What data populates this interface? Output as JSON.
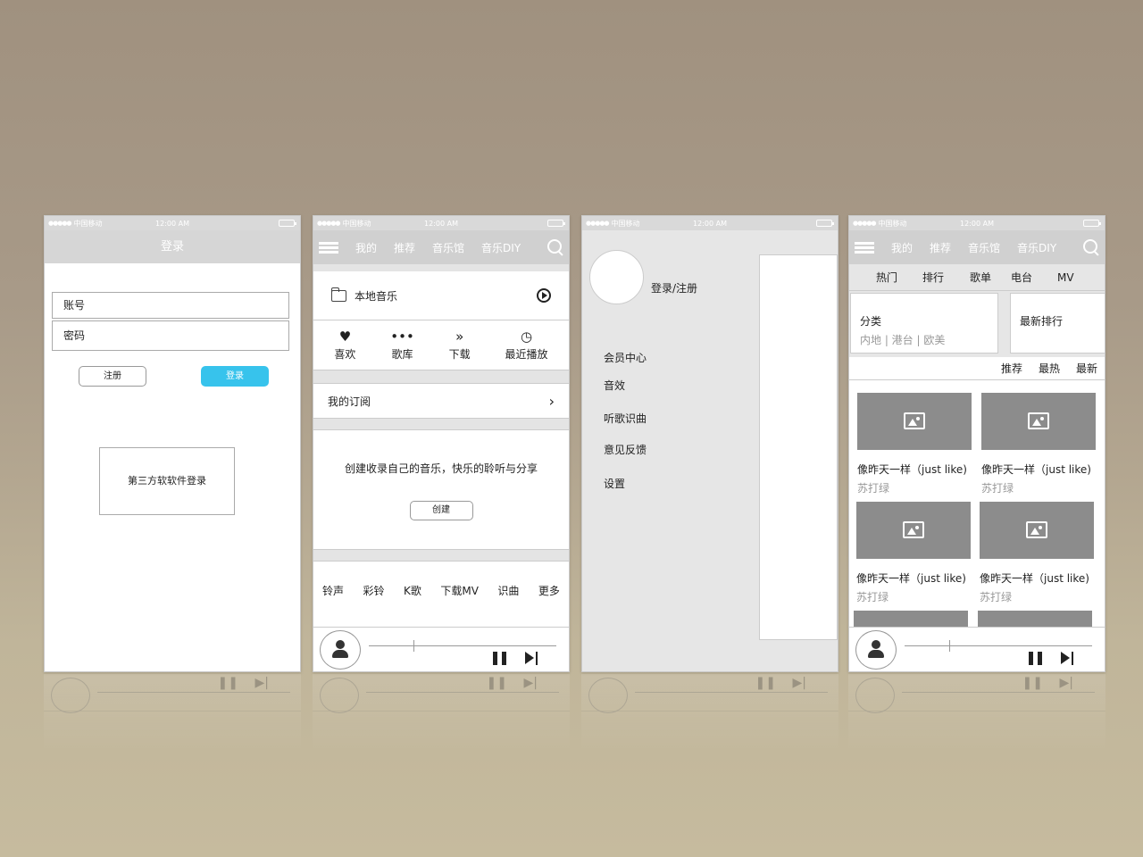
{
  "status_bar": {
    "signal": "●●●●●",
    "carrier": "中国移动",
    "time": "12:00 AM"
  },
  "login_screen": {
    "title": "登录",
    "account_placeholder": "账号",
    "password_placeholder": "密码",
    "register_label": "注册",
    "login_label": "登录",
    "third_party_label": "第三方软软件登录"
  },
  "nav": {
    "tabs": [
      "我的",
      "推荐",
      "音乐馆",
      "音乐DIY"
    ]
  },
  "my_screen": {
    "local_music": "本地音乐",
    "quick": [
      "喜欢",
      "歌库",
      "下载",
      "最近播放"
    ],
    "subscription": "我的订阅",
    "create_prompt": "创建收录自己的音乐，快乐的聆听与分享",
    "create_label": "创建",
    "tools": [
      "铃声",
      "彩铃",
      "K歌",
      "下载MV",
      "识曲",
      "更多"
    ]
  },
  "drawer_screen": {
    "login_register": "登录/注册",
    "menu": [
      "会员中心",
      "音效",
      "听歌识曲",
      "意见反馈",
      "设置"
    ]
  },
  "music_hall": {
    "subtabs": [
      "热门",
      "排行",
      "歌单",
      "电台",
      "MV"
    ],
    "category_title": "分类",
    "category_sub": "内地 | 港台 | 欧美",
    "latest_rank": "最新排行",
    "sort": [
      "推荐",
      "最热",
      "最新"
    ],
    "cards": [
      {
        "title": "像昨天一样（just like)",
        "artist": "苏打绿"
      },
      {
        "title": "像昨天一样（just like)",
        "artist": "苏打绿"
      },
      {
        "title": "像昨天一样（just like)",
        "artist": "苏打绿"
      },
      {
        "title": "像昨天一样（just like)",
        "artist": "苏打绿"
      }
    ]
  },
  "colors": {
    "accent": "#37c3ec",
    "header": "#d6d6d6",
    "placeholder_image": "#8c8c8c"
  }
}
